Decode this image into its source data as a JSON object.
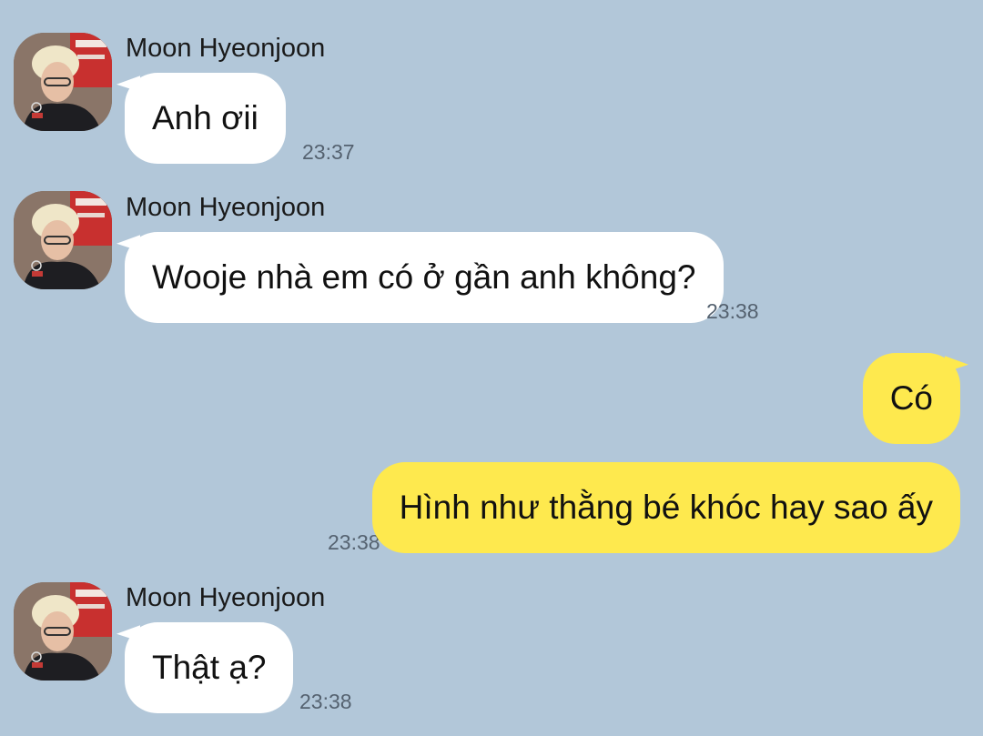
{
  "messages": [
    {
      "sender": "Moon Hyeonjoon",
      "text": "Anh ơii",
      "time": "23:37",
      "direction": "incoming"
    },
    {
      "sender": "Moon Hyeonjoon",
      "text": "Wooje nhà em có ở gần anh không?",
      "time": "23:38",
      "direction": "incoming"
    },
    {
      "text": "Có",
      "direction": "outgoing"
    },
    {
      "text": "Hình như thằng bé khóc hay sao ấy",
      "time": "23:38",
      "direction": "outgoing"
    },
    {
      "sender": "Moon Hyeonjoon",
      "text": "Thật ạ?",
      "time": "23:38",
      "direction": "incoming"
    }
  ],
  "colors": {
    "background": "#b2c7d9",
    "incoming_bubble": "#ffffff",
    "outgoing_bubble": "#fee94e",
    "timestamp": "#556270"
  },
  "icons": {
    "avatar": "profile-photo"
  }
}
